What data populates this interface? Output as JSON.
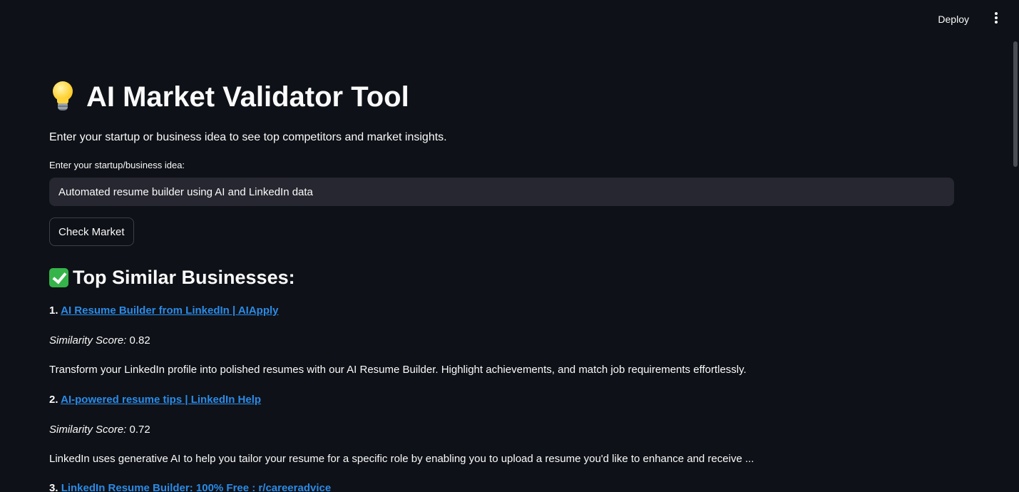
{
  "header": {
    "deploy_label": "Deploy"
  },
  "main": {
    "title": "AI Market Validator Tool",
    "subtitle": "Enter your startup or business idea to see top competitors and market insights.",
    "input_label": "Enter your startup/business idea:",
    "input_value": "Automated resume builder using AI and LinkedIn data",
    "check_button": "Check Market",
    "results_heading": "Top Similar Businesses:",
    "score_label": "Similarity Score:",
    "results": [
      {
        "number": "1.",
        "title": "AI Resume Builder from LinkedIn | AIApply",
        "score": "0.82",
        "description": "Transform your LinkedIn profile into polished resumes with our AI Resume Builder. Highlight achievements, and match job requirements effortlessly."
      },
      {
        "number": "2.",
        "title": "AI-powered resume tips | LinkedIn Help",
        "score": "0.72",
        "description": "LinkedIn uses generative AI to help you tailor your resume for a specific role by enabling you to upload a resume you'd like to enhance and receive ..."
      },
      {
        "number": "3.",
        "title": "LinkedIn Resume Builder: 100% Free : r/careeradvice"
      }
    ]
  },
  "icons": {
    "title_icon": "lightbulb-icon",
    "section_icon": "check-mark-icon",
    "menu_icon": "more-vertical-icon"
  },
  "colors": {
    "background": "#0e1117",
    "input_background": "#262730",
    "link": "#2b8be8",
    "check_icon": "#35b44a"
  }
}
